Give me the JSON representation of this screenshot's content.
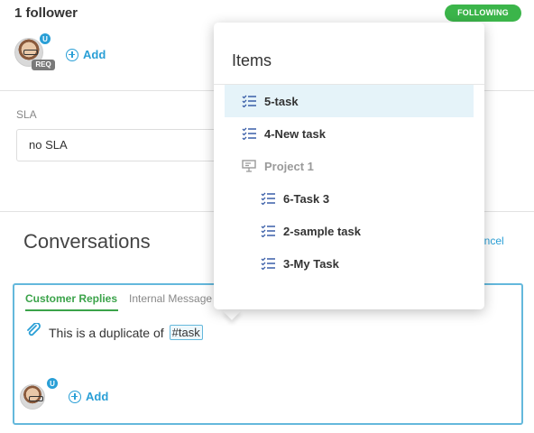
{
  "followers": {
    "title": "1 follower",
    "following_label": "FOLLOWING",
    "user_badge": "U",
    "req_badge": "REQ",
    "add_label": "Add"
  },
  "sla": {
    "label": "SLA",
    "value": "no SLA"
  },
  "conversations": {
    "title": "Conversations",
    "cancel_label": "ancel",
    "tabs": [
      "Customer Replies",
      "Internal Message"
    ],
    "message_text": "This is a duplicate of",
    "mention_text": "#task",
    "user_badge": "U",
    "add_label": "Add"
  },
  "popup": {
    "title": "Items",
    "items": [
      {
        "label": "5-task",
        "icon": "task-list-icon"
      },
      {
        "label": "4-New task",
        "icon": "task-list-icon"
      },
      {
        "label": "Project 1",
        "icon": "project-board-icon"
      },
      {
        "label": "6-Task 3",
        "icon": "task-list-icon"
      },
      {
        "label": "2-sample task",
        "icon": "task-list-icon"
      },
      {
        "label": "3-My Task",
        "icon": "task-list-icon"
      }
    ]
  },
  "colors": {
    "accent": "#2a9fd6",
    "following_green": "#3bb54a",
    "tab_green": "#3ba34a",
    "selected_bg": "#e5f3f9",
    "task_icon": "#3a5fa8"
  }
}
